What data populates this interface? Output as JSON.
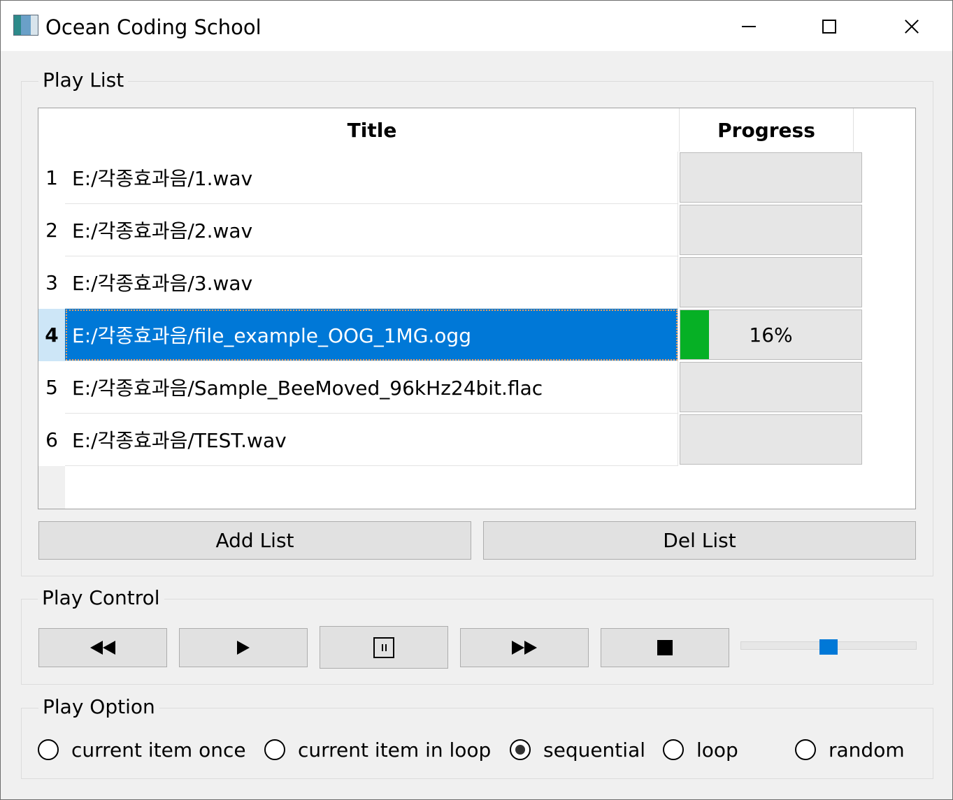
{
  "window": {
    "title": "Ocean Coding School",
    "app_icon": "media-player-app-icon",
    "controls": [
      "minimize-icon",
      "maximize-icon",
      "close-icon"
    ]
  },
  "playlist": {
    "group_title": "Play List",
    "columns": [
      "Title",
      "Progress"
    ],
    "rows": [
      {
        "num": "1",
        "title": "E:/각종효과음/1.wav",
        "progress_text": "",
        "progress": 0
      },
      {
        "num": "2",
        "title": "E:/각종효과음/2.wav",
        "progress_text": "",
        "progress": 0
      },
      {
        "num": "3",
        "title": "E:/각종효과음/3.wav",
        "progress_text": "",
        "progress": 0
      },
      {
        "num": "4",
        "title": "E:/각종효과음/file_example_OOG_1MG.ogg",
        "progress_text": "16%",
        "progress": 0.16,
        "selected": true
      },
      {
        "num": "5",
        "title": "E:/각종효과음/Sample_BeeMoved_96kHz24bit.flac",
        "progress_text": "",
        "progress": 0
      },
      {
        "num": "6",
        "title": "E:/각종효과음/TEST.wav",
        "progress_text": "",
        "progress": 0
      }
    ],
    "add_button": "Add List",
    "del_button": "Del List"
  },
  "play_control": {
    "group_title": "Play Control",
    "buttons": [
      "previous-icon",
      "play-icon",
      "pause-icon",
      "next-icon",
      "stop-icon"
    ],
    "volume_level": 0.5
  },
  "play_option": {
    "group_title": "Play Option",
    "options": [
      {
        "label": "current item once",
        "checked": false
      },
      {
        "label": "current item in loop",
        "checked": false
      },
      {
        "label": "sequential",
        "checked": true
      },
      {
        "label": "loop",
        "checked": false
      },
      {
        "label": "random",
        "checked": false
      }
    ]
  },
  "colors": {
    "selection": "#0078d7",
    "progress_fill": "#06b025",
    "slider_handle": "#0078d7"
  }
}
